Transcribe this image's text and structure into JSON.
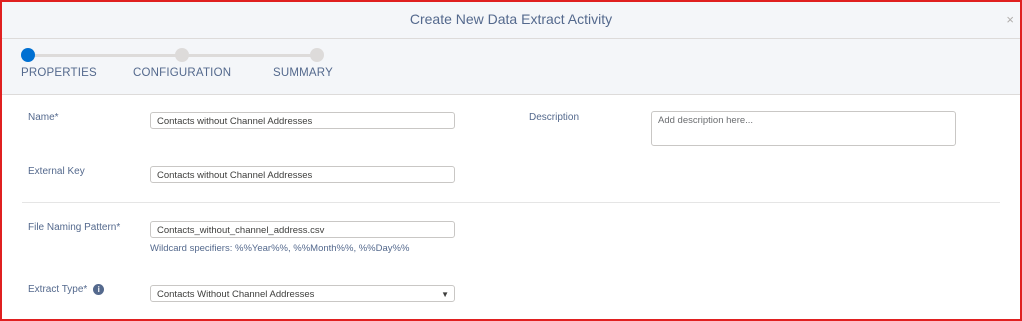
{
  "header": {
    "title": "Create New Data Extract Activity",
    "close_icon": "×"
  },
  "steps": [
    {
      "label": "PROPERTIES",
      "active": true
    },
    {
      "label": "CONFIGURATION",
      "active": false
    },
    {
      "label": "SUMMARY",
      "active": false
    }
  ],
  "form": {
    "name": {
      "label": "Name*",
      "value": "Contacts without Channel Addresses"
    },
    "description": {
      "label": "Description",
      "placeholder": "Add description here..."
    },
    "external_key": {
      "label": "External Key",
      "value": "Contacts without Channel Addresses"
    },
    "file_naming_pattern": {
      "label": "File Naming Pattern*",
      "value": "Contacts_without_channel_address.csv",
      "hint": "Wildcard specifiers: %%Year%%, %%Month%%, %%Day%%"
    },
    "extract_type": {
      "label": "Extract Type*",
      "info_icon": "i",
      "value": "Contacts Without Channel Addresses"
    }
  },
  "colors": {
    "accent": "#0070d2",
    "border_highlight": "#e02020"
  }
}
